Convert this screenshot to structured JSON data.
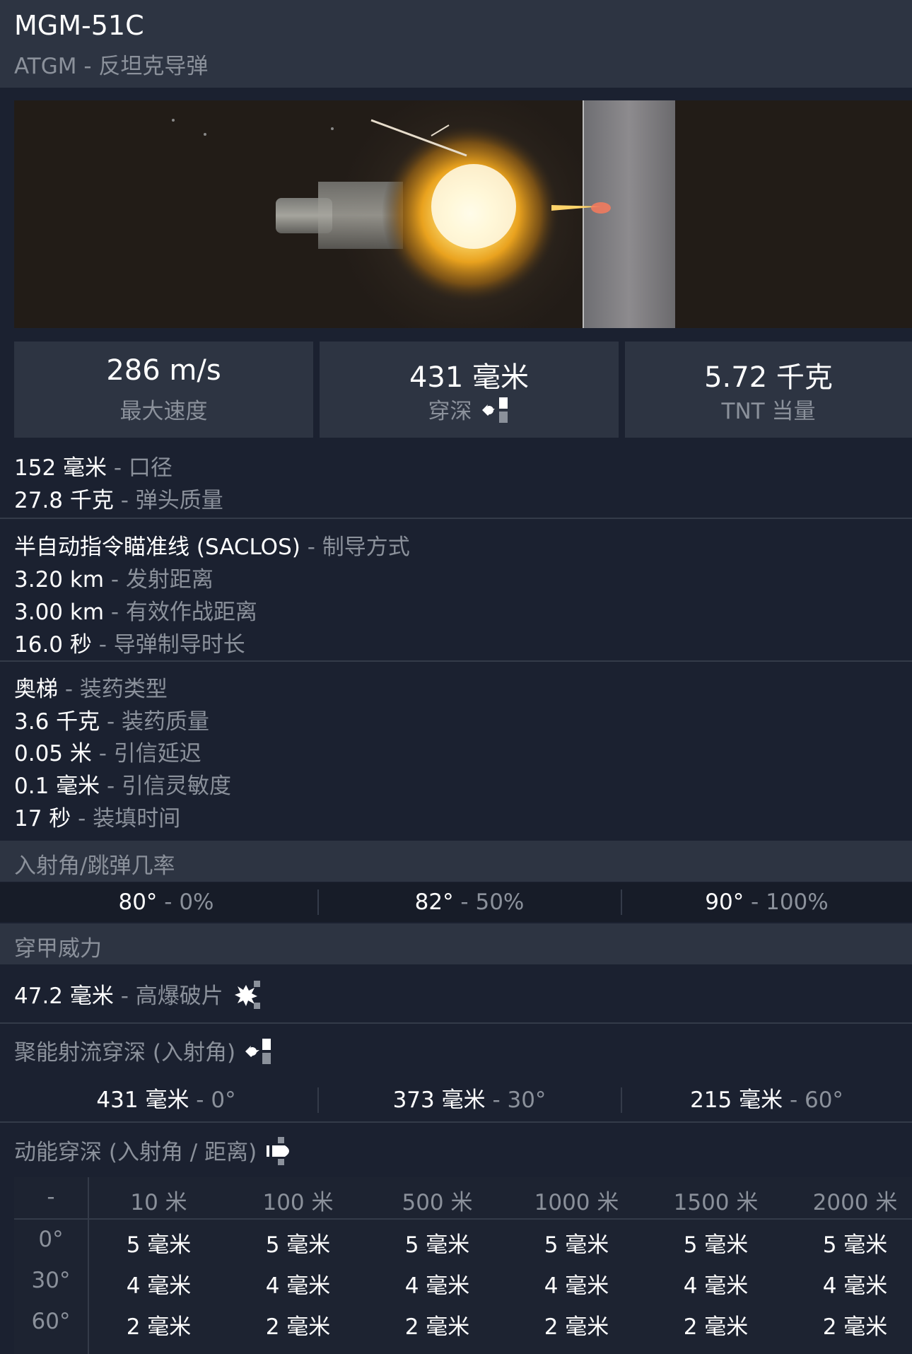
{
  "header": {
    "title": "MGM-51C",
    "subtitle": "ATGM - 反坦克导弹"
  },
  "stats": [
    {
      "value": "286 m/s",
      "label": "最大速度"
    },
    {
      "value": "431 毫米",
      "label": "穿深",
      "icon": "shaped-charge-penetration-icon"
    },
    {
      "value": "5.72 千克",
      "label": "TNT 当量"
    }
  ],
  "group1": [
    {
      "value": "152 毫米",
      "desc": " - 口径"
    },
    {
      "value": "27.8 千克",
      "desc": " - 弹头质量"
    }
  ],
  "group2": [
    {
      "value": "半自动指令瞄准线 (SACLOS)",
      "desc": " - 制导方式"
    },
    {
      "value": "3.20 km",
      "desc": " - 发射距离"
    },
    {
      "value": "3.00 km",
      "desc": " - 有效作战距离"
    },
    {
      "value": "16.0 秒",
      "desc": " - 导弹制导时长"
    }
  ],
  "group3": [
    {
      "value": "奥梯",
      "desc": " - 装药类型"
    },
    {
      "value": "3.6 千克",
      "desc": " - 装药质量"
    },
    {
      "value": "0.05 米",
      "desc": " - 引信延迟"
    },
    {
      "value": "0.1 毫米",
      "desc": " - 引信灵敏度"
    },
    {
      "value": "17 秒",
      "desc": " - 装填时间"
    }
  ],
  "ricochet": {
    "title": "入射角/跳弹几率",
    "cells": [
      {
        "value": "80°",
        "desc": " - 0%"
      },
      {
        "value": "82°",
        "desc": " - 50%"
      },
      {
        "value": "90°",
        "desc": " - 100%"
      }
    ]
  },
  "armor_power": {
    "title": "穿甲威力",
    "he_frag": {
      "value": "47.2 毫米",
      "desc": " - 高爆破片",
      "icon": "he-fragmentation-icon"
    }
  },
  "heat": {
    "title": "聚能射流穿深 (入射角)",
    "icon": "shaped-charge-jet-icon",
    "cells": [
      {
        "value": "431 毫米",
        "desc": " - 0°"
      },
      {
        "value": "373 毫米",
        "desc": " - 30°"
      },
      {
        "value": "215 毫米",
        "desc": " - 60°"
      }
    ]
  },
  "kinetic": {
    "title": "动能穿深 (入射角 / 距离)",
    "icon": "kinetic-penetration-icon",
    "corner": "-",
    "distances": [
      "10 米",
      "100 米",
      "500 米",
      "1000 米",
      "1500 米",
      "2000 米"
    ],
    "rows": [
      {
        "angle": "0°",
        "values": [
          "5 毫米",
          "5 毫米",
          "5 毫米",
          "5 毫米",
          "5 毫米",
          "5 毫米"
        ]
      },
      {
        "angle": "30°",
        "values": [
          "4 毫米",
          "4 毫米",
          "4 毫米",
          "4 毫米",
          "4 毫米",
          "4 毫米"
        ]
      },
      {
        "angle": "60°",
        "values": [
          "2 毫米",
          "2 毫米",
          "2 毫米",
          "2 毫米",
          "2 毫米",
          "2 毫米"
        ]
      }
    ]
  }
}
